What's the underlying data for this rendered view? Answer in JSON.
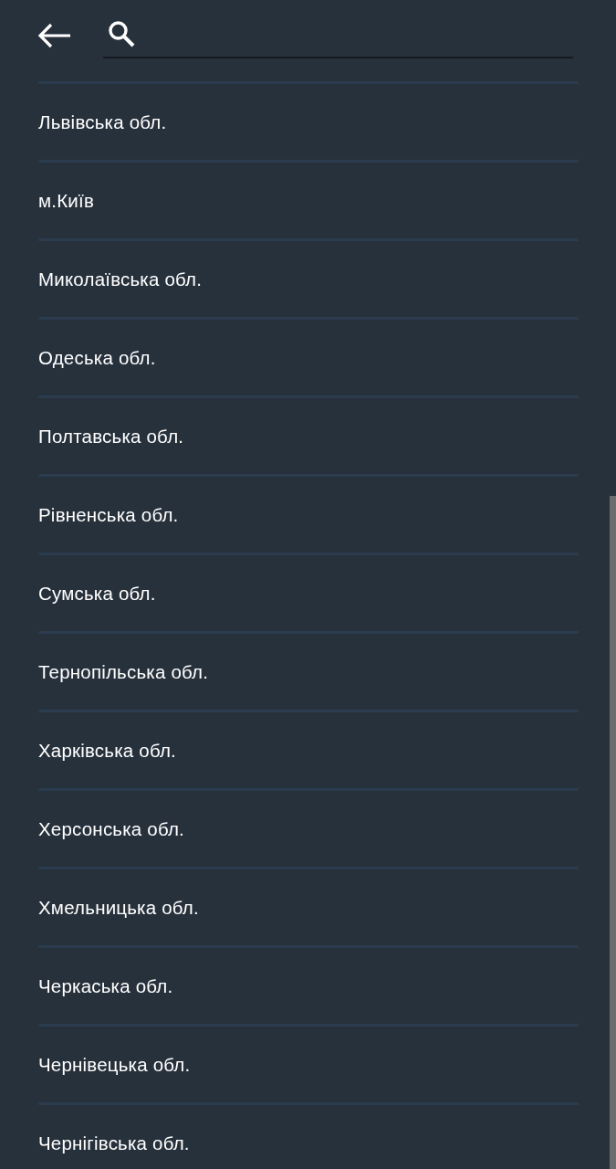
{
  "regions": [
    {
      "name": "Львівська обл."
    },
    {
      "name": "м.Київ"
    },
    {
      "name": "Миколаївська обл."
    },
    {
      "name": "Одеська обл."
    },
    {
      "name": "Полтавська обл."
    },
    {
      "name": "Рівненська обл."
    },
    {
      "name": "Сумська обл."
    },
    {
      "name": "Тернопільська обл."
    },
    {
      "name": "Харківська обл."
    },
    {
      "name": "Херсонська обл."
    },
    {
      "name": "Хмельницька обл."
    },
    {
      "name": "Черкаська обл."
    },
    {
      "name": "Чернівецька обл."
    },
    {
      "name": "Чернігівська обл."
    }
  ]
}
